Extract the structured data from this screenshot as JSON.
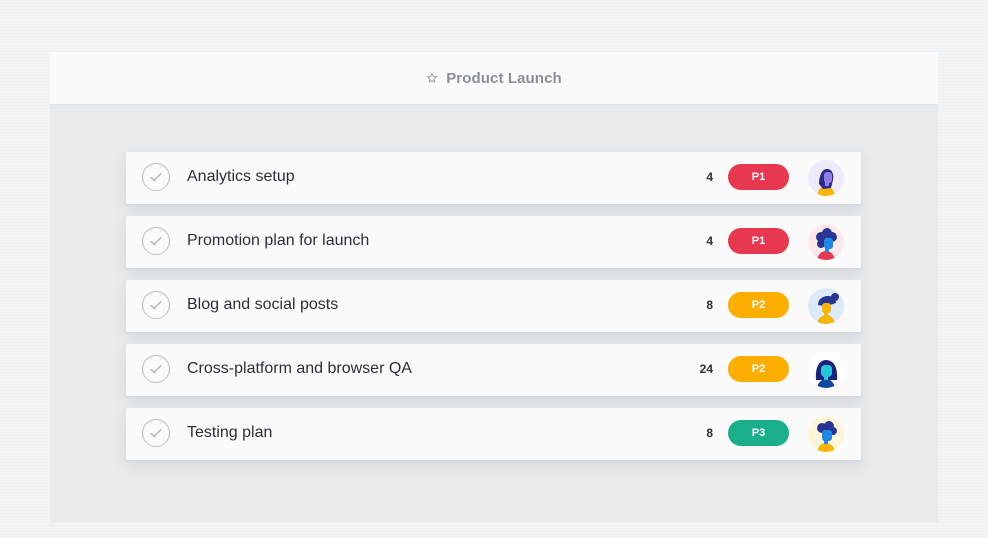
{
  "project": {
    "title": "Product Launch",
    "icon": "star-icon"
  },
  "tasks": [
    {
      "name": "Analytics setup",
      "count": "4",
      "priority": "P1",
      "priority_color": "#e8384f",
      "avatar_bg": "#f0ebfb"
    },
    {
      "name": "Promotion plan for launch",
      "count": "4",
      "priority": "P1",
      "priority_color": "#e8384f",
      "avatar_bg": "#fbe9ec"
    },
    {
      "name": "Blog and social posts",
      "count": "8",
      "priority": "P2",
      "priority_color": "#fdae00",
      "avatar_bg": "#dbe9f8"
    },
    {
      "name": "Cross-platform and browser QA",
      "count": "24",
      "priority": "P2",
      "priority_color": "#fdae00",
      "avatar_bg": "#ffffff"
    },
    {
      "name": "Testing plan",
      "count": "8",
      "priority": "P3",
      "priority_color": "#1aaf8b",
      "avatar_bg": "#fff6da"
    }
  ]
}
